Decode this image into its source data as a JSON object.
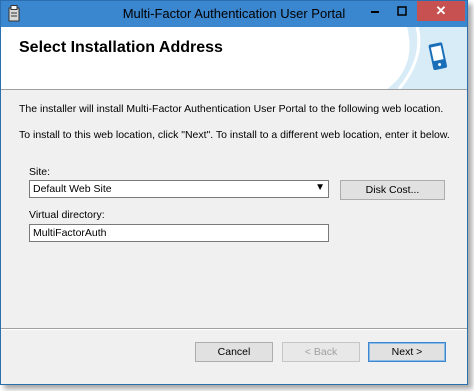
{
  "window": {
    "title": "Multi-Factor Authentication User Portal",
    "minimize_glyph": "—",
    "maximize_glyph": "□",
    "close_glyph": "✕"
  },
  "header": {
    "title": "Select Installation Address"
  },
  "body": {
    "line1": "The installer will install Multi-Factor Authentication User Portal to the following web location.",
    "line2": "To install to this web location, click \"Next\". To install to a different web location, enter it below."
  },
  "site": {
    "label": "Site:",
    "selected": "Default Web Site",
    "arrow": "▼"
  },
  "disk_cost_label": "Disk Cost...",
  "virtual_directory": {
    "label": "Virtual directory:",
    "value": "MultiFactorAuth"
  },
  "footer": {
    "cancel_label": "Cancel",
    "back_label": "< Back",
    "next_label": "Next >"
  },
  "colors": {
    "titlebar": "#3a86cf",
    "close": "#c75050",
    "banner_stripe": "#d8ecf7"
  }
}
